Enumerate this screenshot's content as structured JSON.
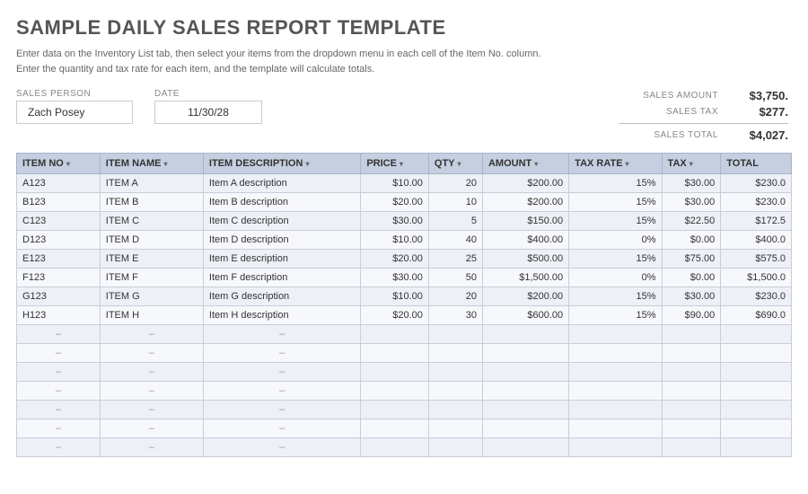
{
  "title": "SAMPLE DAILY SALES REPORT TEMPLATE",
  "subtitle_line1": "Enter data on the Inventory List tab, then select your items from the dropdown menu in each cell of the Item No. column.",
  "subtitle_line2": "Enter the quantity and tax rate for each item, and the template will calculate totals.",
  "sales_person_label": "SALES PERSON",
  "sales_person_value": "Zach Posey",
  "date_label": "DATE",
  "date_value": "11/30/28",
  "summary": {
    "sales_amount_label": "SALES AMOUNT",
    "sales_amount_value": "$3,750.",
    "sales_tax_label": "SALES TAX",
    "sales_tax_value": "$277.",
    "sales_total_label": "SALES TOTAL",
    "sales_total_value": "$4,027."
  },
  "table": {
    "headers": [
      {
        "label": "ITEM NO",
        "sort": true
      },
      {
        "label": "ITEM NAME",
        "sort": true
      },
      {
        "label": "ITEM DESCRIPTION",
        "sort": true
      },
      {
        "label": "PRICE",
        "sort": true
      },
      {
        "label": "QTY",
        "sort": true
      },
      {
        "label": "AMOUNT",
        "sort": true
      },
      {
        "label": "TAX RATE",
        "sort": true
      },
      {
        "label": "TAX",
        "sort": true
      },
      {
        "label": "TOTAL",
        "sort": false
      }
    ],
    "rows": [
      {
        "item_no": "A123",
        "item_name": "ITEM A",
        "description": "Item A description",
        "price": "$10.00",
        "qty": "20",
        "amount": "$200.00",
        "tax_rate": "15%",
        "tax": "$30.00",
        "total": "$230.0"
      },
      {
        "item_no": "B123",
        "item_name": "ITEM B",
        "description": "Item B description",
        "price": "$20.00",
        "qty": "10",
        "amount": "$200.00",
        "tax_rate": "15%",
        "tax": "$30.00",
        "total": "$230.0"
      },
      {
        "item_no": "C123",
        "item_name": "ITEM C",
        "description": "Item C description",
        "price": "$30.00",
        "qty": "5",
        "amount": "$150.00",
        "tax_rate": "15%",
        "tax": "$22.50",
        "total": "$172.5"
      },
      {
        "item_no": "D123",
        "item_name": "ITEM D",
        "description": "Item D description",
        "price": "$10.00",
        "qty": "40",
        "amount": "$400.00",
        "tax_rate": "0%",
        "tax": "$0.00",
        "total": "$400.0"
      },
      {
        "item_no": "E123",
        "item_name": "ITEM E",
        "description": "Item E description",
        "price": "$20.00",
        "qty": "25",
        "amount": "$500.00",
        "tax_rate": "15%",
        "tax": "$75.00",
        "total": "$575.0"
      },
      {
        "item_no": "F123",
        "item_name": "ITEM F",
        "description": "Item F description",
        "price": "$30.00",
        "qty": "50",
        "amount": "$1,500.00",
        "tax_rate": "0%",
        "tax": "$0.00",
        "total": "$1,500.0"
      },
      {
        "item_no": "G123",
        "item_name": "ITEM G",
        "description": "Item G description",
        "price": "$10.00",
        "qty": "20",
        "amount": "$200.00",
        "tax_rate": "15%",
        "tax": "$30.00",
        "total": "$230.0"
      },
      {
        "item_no": "H123",
        "item_name": "ITEM H",
        "description": "Item H description",
        "price": "$20.00",
        "qty": "30",
        "amount": "$600.00",
        "tax_rate": "15%",
        "tax": "$90.00",
        "total": "$690.0"
      }
    ],
    "empty_rows": 7,
    "dash": "–"
  }
}
